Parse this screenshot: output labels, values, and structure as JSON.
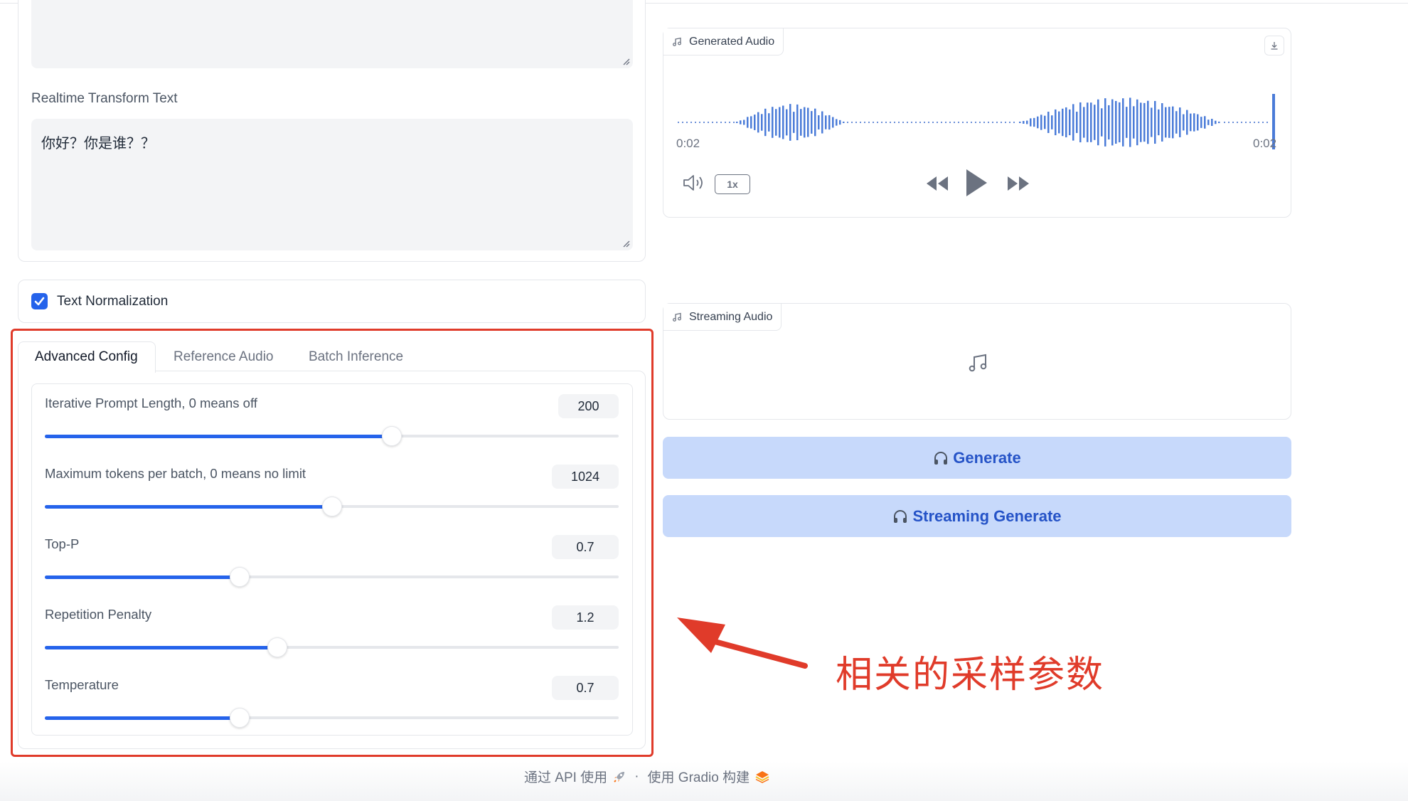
{
  "left": {
    "realtime_label": "Realtime Transform Text",
    "realtime_value": "你好？你是谁？？",
    "text_normalization": {
      "label": "Text Normalization",
      "checked": true
    },
    "tabs": [
      {
        "label": "Advanced Config",
        "active": true
      },
      {
        "label": "Reference Audio",
        "active": false
      },
      {
        "label": "Batch Inference",
        "active": false
      }
    ],
    "sliders": [
      {
        "label": "Iterative Prompt Length, 0 means off",
        "value": "200",
        "fraction": 0.605
      },
      {
        "label": "Maximum tokens per batch, 0 means no limit",
        "value": "1024",
        "fraction": 0.5
      },
      {
        "label": "Top-P",
        "value": "0.7",
        "fraction": 0.34
      },
      {
        "label": "Repetition Penalty",
        "value": "1.2",
        "fraction": 0.405
      },
      {
        "label": "Temperature",
        "value": "0.7",
        "fraction": 0.34
      }
    ]
  },
  "right": {
    "generated_audio": {
      "label": "Generated Audio",
      "time_current": "0:02",
      "time_total": "0:02",
      "speed": "1x"
    },
    "streaming_audio": {
      "label": "Streaming Audio"
    },
    "generate_button": "Generate",
    "streaming_generate_button": "Streaming Generate"
  },
  "annotation": {
    "text": "相关的采样参数",
    "color": "#e03b2a"
  },
  "footer": {
    "api_text": "通过 API 使用",
    "separator": "·",
    "built_text": "使用 Gradio 构建"
  },
  "colors": {
    "accent": "#2563eb",
    "button_bg": "#c7d9fb",
    "button_text": "#2553c7"
  }
}
